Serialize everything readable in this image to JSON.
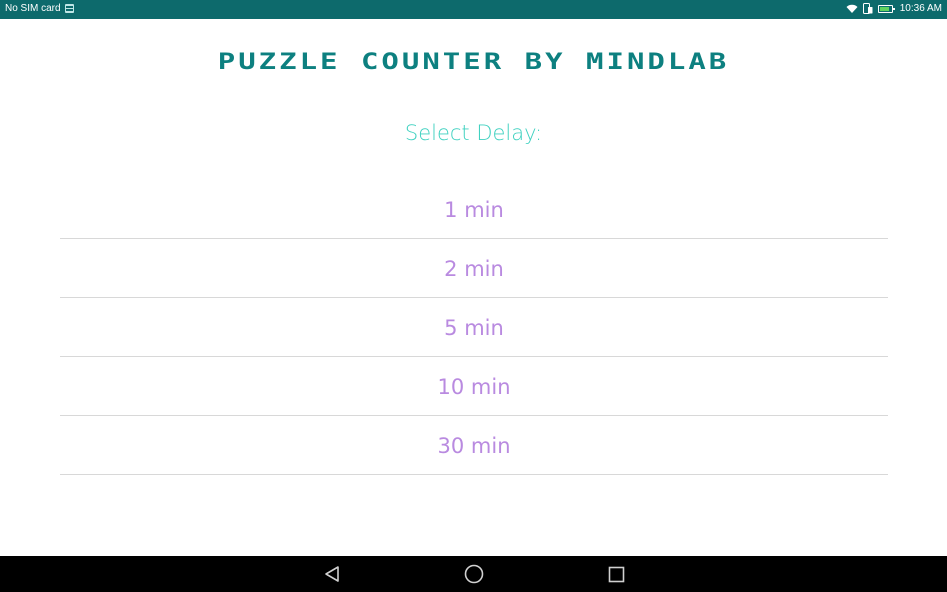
{
  "status_bar": {
    "carrier_text": "No SIM card",
    "time": "10:36 AM",
    "icons": [
      "sim-card-icon",
      "wifi-icon",
      "device-icon",
      "battery-icon"
    ],
    "battery_level": 0.85,
    "battery_color": "#5fd35f"
  },
  "header": {
    "title": "puzzle counter by mindlab",
    "subtitle": "Select Delay:"
  },
  "delay_options": [
    {
      "label": "1 min"
    },
    {
      "label": "2 min"
    },
    {
      "label": "5 min"
    },
    {
      "label": "10 min"
    },
    {
      "label": "30 min"
    }
  ],
  "nav_bar": {
    "buttons": [
      "back-icon",
      "home-icon",
      "recents-icon"
    ]
  },
  "colors": {
    "status_bar_bg": "#0d6a6c",
    "title": "#0d8080",
    "subtitle": "#3fd1c0",
    "option_text": "#b98ae0",
    "divider": "#d8d8d8",
    "nav_bar_bg": "#000000"
  }
}
